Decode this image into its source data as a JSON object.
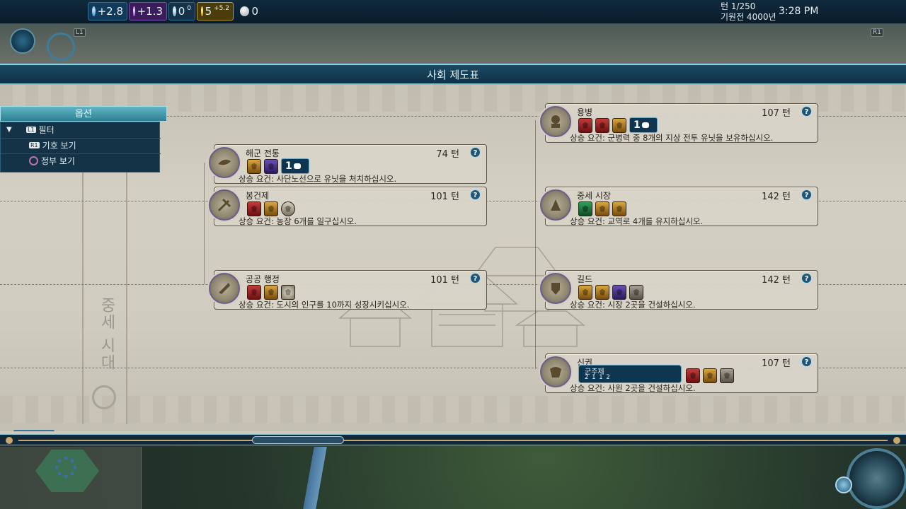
{
  "resources": {
    "science": "+2.8",
    "faith": "+1.3",
    "culture": "0",
    "culture_sup": "0",
    "gold": "5",
    "gold_sup": "+5.2",
    "envoys": "0"
  },
  "turn_info": {
    "turn": "턴 1/250",
    "date": "기원전 4000년",
    "clock": "3:28 PM"
  },
  "hints": {
    "l1": "L1",
    "r1": "R1"
  },
  "panel": {
    "title": "사회 제도표"
  },
  "options": {
    "header": "옵션",
    "items": [
      {
        "badge": "L1",
        "label": "필터"
      },
      {
        "badge": "R1",
        "label": "기호 보기"
      },
      {
        "badge": "",
        "label": "정부 보기"
      }
    ]
  },
  "era": {
    "label": "중세 시대"
  },
  "civics": [
    {
      "name": "해군 전통",
      "turns": "74 턴",
      "requirement": "상승 요건: 사단노선으로 유닛을 처치하십시오.",
      "slots": [
        "eco",
        "wild"
      ],
      "envoy": "1"
    },
    {
      "name": "봉건제",
      "turns": "101 턴",
      "requirement": "상승 요건: 농장 6개를 일구십시오.",
      "slots": [
        "mil",
        "eco",
        "great"
      ]
    },
    {
      "name": "공공 행정",
      "turns": "101 턴",
      "requirement": "상승 요건: 도시의 인구를 10까지 성장시키십시오.",
      "slots": [
        "mil",
        "eco",
        "gp"
      ]
    },
    {
      "name": "용병",
      "turns": "107 턴",
      "requirement": "상승 요건: 군병력 중 8개의 지상 전투 유닛을 보유하십시오.",
      "slots": [
        "mil",
        "mil",
        "eco"
      ],
      "envoy": "1"
    },
    {
      "name": "중세 시장",
      "turns": "142 턴",
      "requirement": "상승 요건: 교역로 4개를 유지하십시오.",
      "slots": [
        "dip",
        "eco",
        "eco"
      ]
    },
    {
      "name": "길드",
      "turns": "142 턴",
      "requirement": "상승 요건: 시장 2곳을 건설하십시오.",
      "slots": [
        "eco",
        "eco",
        "wild",
        "unit"
      ]
    },
    {
      "name": "신권",
      "turns": "107 턴",
      "requirement": "상승 요건: 사원 2곳을 건설하십시오.",
      "slots": [
        "mil",
        "eco",
        "unit"
      ],
      "government": {
        "title": "군주제",
        "values": "2  1  1  2"
      }
    }
  ],
  "help_symbol": "?",
  "footer": {
    "turn_label": "턴",
    "turn_value": "1"
  }
}
